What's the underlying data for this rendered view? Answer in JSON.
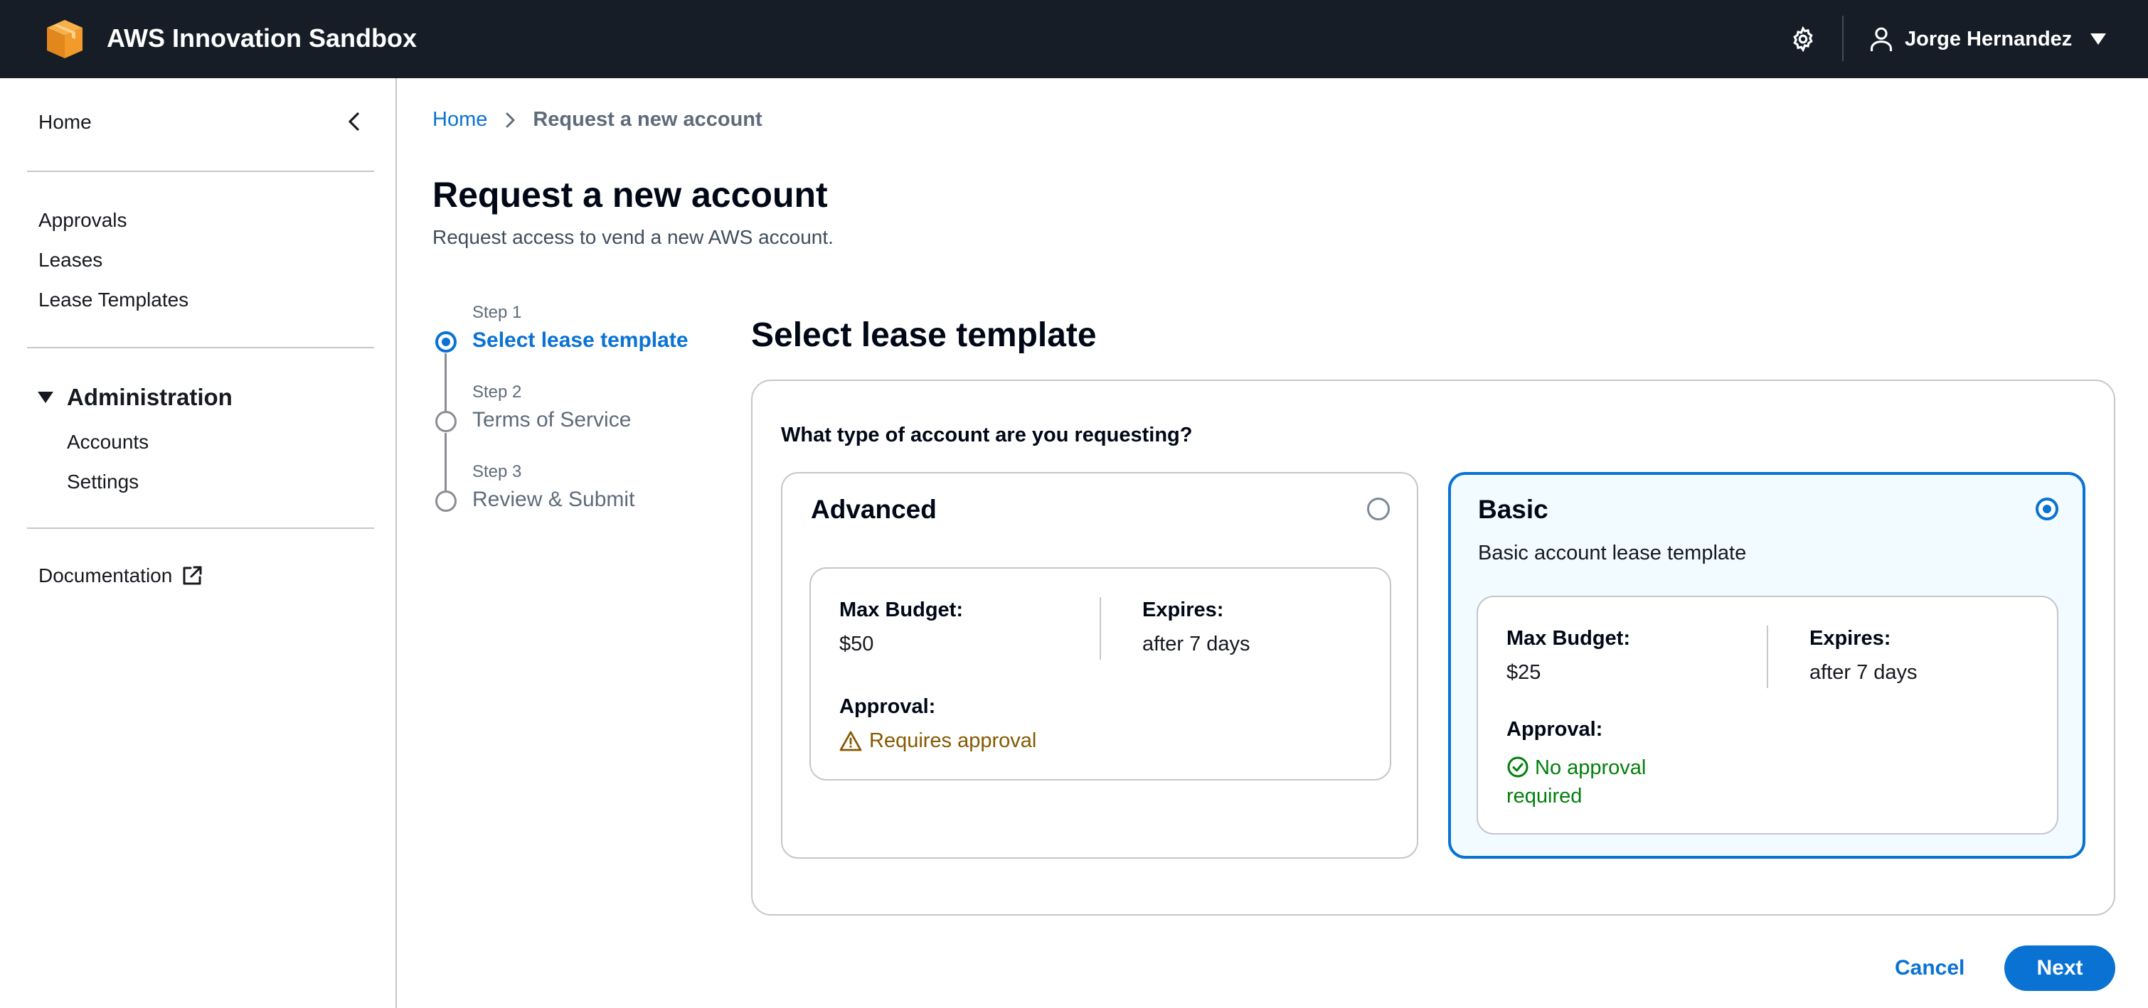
{
  "header": {
    "app_title": "AWS Innovation Sandbox",
    "user_name": "Jorge Hernandez",
    "icons": [
      "aws-logo-icon",
      "gear-icon",
      "user-icon",
      "caret-down-icon"
    ]
  },
  "sidebar": {
    "home": "Home",
    "items": [
      {
        "label": "Approvals"
      },
      {
        "label": "Leases"
      },
      {
        "label": "Lease Templates"
      }
    ],
    "admin_section": {
      "label": "Administration",
      "expanded": true,
      "items": [
        {
          "label": "Accounts"
        },
        {
          "label": "Settings"
        }
      ]
    },
    "documentation": "Documentation"
  },
  "breadcrumb": {
    "home": "Home",
    "current": "Request a new account"
  },
  "page": {
    "title": "Request a new account",
    "description": "Request access to vend a new AWS account."
  },
  "wizard": {
    "active_step": 1,
    "steps": [
      {
        "small": "Step 1",
        "label": "Select lease template"
      },
      {
        "small": "Step 2",
        "label": "Terms of Service"
      },
      {
        "small": "Step 3",
        "label": "Review & Submit"
      }
    ]
  },
  "form": {
    "section_title": "Select lease template",
    "question": "What type of account are you requesting?",
    "selected": "Basic",
    "templates": [
      {
        "name": "Advanced",
        "description": "",
        "max_budget_label": "Max Budget:",
        "max_budget": "$50",
        "expires_label": "Expires:",
        "expires": "after 7 days",
        "approval_label": "Approval:",
        "approval": "Requires approval",
        "approval_status": "warning"
      },
      {
        "name": "Basic",
        "description": "Basic account lease template",
        "max_budget_label": "Max Budget:",
        "max_budget": "$25",
        "expires_label": "Expires:",
        "expires": "after 7 days",
        "approval_label": "Approval:",
        "approval": "No approval required",
        "approval_status": "success"
      }
    ]
  },
  "actions": {
    "cancel": "Cancel",
    "next": "Next"
  },
  "colors": {
    "header_bg": "#161d26",
    "accent": "#0972d3",
    "warning": "#855900",
    "success": "#037f0c",
    "selected_tile_bg": "#f2fbff"
  }
}
